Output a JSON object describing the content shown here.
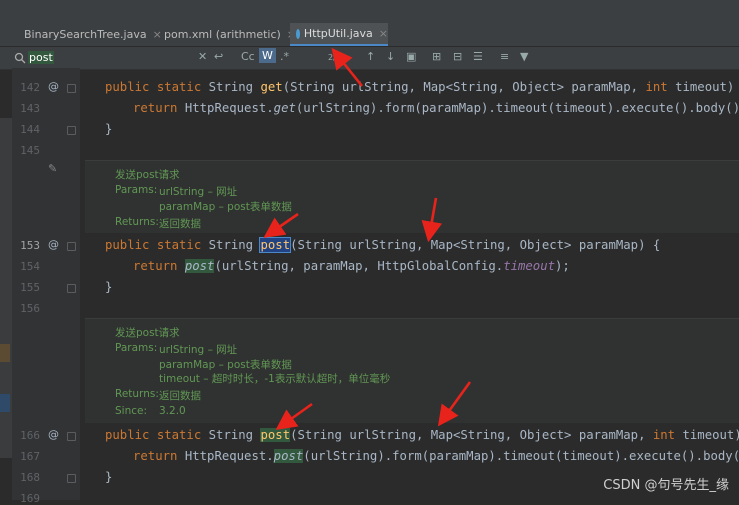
{
  "tabs": [
    {
      "label": "BinarySearchTree.java",
      "close": "×",
      "active": false,
      "icon_color": "#4a9bd1"
    },
    {
      "label": "pom.xml (arithmetic)",
      "close": "×",
      "active": false,
      "icon_color": "#7f8c9c"
    },
    {
      "label": "HttpUtil.java",
      "close": "×",
      "active": true,
      "icon_color": "#4a9bd1"
    }
  ],
  "find": {
    "query": "post",
    "match_case": "Cc",
    "words": "W",
    "regex": ".*",
    "count": "2/"
  },
  "lines": {
    "l142": "142",
    "l143": "143",
    "l144": "144",
    "l145": "145",
    "l153": "153",
    "l154": "154",
    "l155": "155",
    "l156": "156",
    "l166": "166",
    "l167": "167",
    "l168": "168",
    "l169": "169"
  },
  "code": {
    "get_sig": {
      "kw1": "public static",
      "t1": " String ",
      "name": "get",
      "rest": "(String urlString, Map<String, Object> paramMap, ",
      "kw2": "int",
      "end": " timeout) {"
    },
    "get_ret": {
      "kw": "return",
      "a": " HttpRequest.",
      "m": "get",
      "b": "(urlString).form(paramMap).timeout(timeout).execute().body();"
    },
    "close1": "}",
    "post1_sig": {
      "kw": "public static",
      "t": " String ",
      "name": "post",
      "rest": "(String urlString, Map<String, Object> paramMap) {"
    },
    "post1_ret": {
      "kw": "return",
      "sp": " ",
      "m": "post",
      "b": "(urlString, paramMap, HttpGlobalConfig.",
      "f": "timeout",
      "end": ");"
    },
    "close2": "}",
    "post2_sig": {
      "kw1": "public static",
      "t": " String ",
      "name": "post",
      "rest": "(String urlString, Map<String, Object> paramMap, ",
      "kw2": "int",
      "end": " timeout) {"
    },
    "post2_ret": {
      "kw": "return",
      "a": " HttpRequest.",
      "m": "post",
      "b": "(urlString).form(paramMap).timeout(timeout).execute().body();"
    },
    "close3": "}"
  },
  "doc1": {
    "title": "发送post请求",
    "params_label": "Params:",
    "p1": "urlString – 网址",
    "p2": "paramMap – post表单数据",
    "returns_label": "Returns:",
    "returns": "返回数据"
  },
  "doc2": {
    "title": "发送post请求",
    "params_label": "Params:",
    "p1": "urlString – 网址",
    "p2": "paramMap – post表单数据",
    "p3": "timeout – 超时时长，-1表示默认超时，单位毫秒",
    "returns_label": "Returns:",
    "returns": "返回数据",
    "since_label": "Since:",
    "since": "3.2.0"
  },
  "watermark": "CSDN @句号先生_缘",
  "colors": {
    "arrow": "#e8231c",
    "keyword": "#cc7832",
    "method": "#ffc66d",
    "doc": "#629755"
  }
}
